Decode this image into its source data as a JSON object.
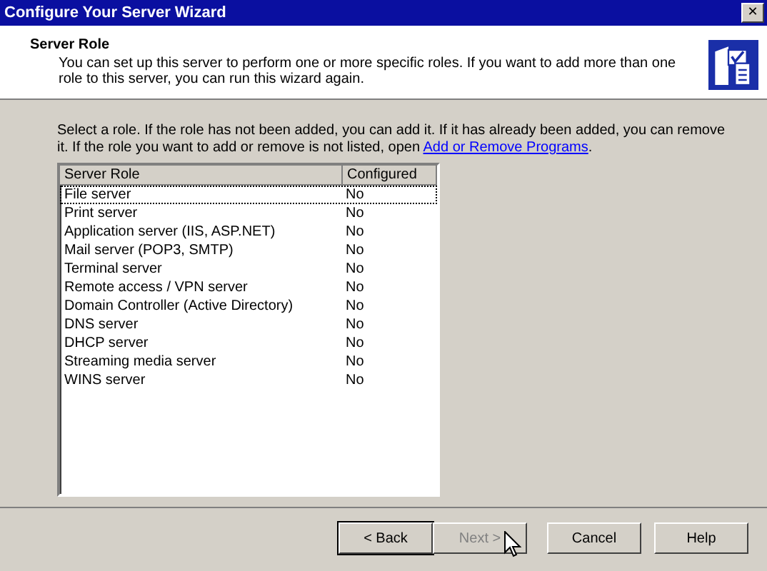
{
  "window": {
    "title": "Configure Your Server Wizard",
    "close": "✕"
  },
  "header": {
    "title": "Server Role",
    "description": "You can set up this server to perform one or more specific roles. If you want to add more than one role to this server, you can run this wizard again."
  },
  "instructions": {
    "text": "Select a role. If the role has not been added, you can add it. If it has already been added, you can remove it. If the role you want to add or remove is not listed, open",
    "link": "Add or Remove Programs",
    "end": "."
  },
  "table": {
    "columns": [
      "Server Role",
      "Configured"
    ],
    "rows": [
      {
        "role": "File server",
        "configured": "No",
        "focused": true
      },
      {
        "role": "Print server",
        "configured": "No",
        "focused": false
      },
      {
        "role": "Application server (IIS, ASP.NET)",
        "configured": "No",
        "focused": false
      },
      {
        "role": "Mail server (POP3, SMTP)",
        "configured": "No",
        "focused": false
      },
      {
        "role": "Terminal server",
        "configured": "No",
        "focused": false
      },
      {
        "role": "Remote access / VPN server",
        "configured": "No",
        "focused": false
      },
      {
        "role": "Domain Controller (Active Directory)",
        "configured": "No",
        "focused": false
      },
      {
        "role": "DNS server",
        "configured": "No",
        "focused": false
      },
      {
        "role": "DHCP server",
        "configured": "No",
        "focused": false
      },
      {
        "role": "Streaming media server",
        "configured": "No",
        "focused": false
      },
      {
        "role": "WINS server",
        "configured": "No",
        "focused": false
      }
    ]
  },
  "buttons": [
    {
      "label": "< Back",
      "disabled": false,
      "default": true
    },
    {
      "label": "Next >",
      "disabled": true,
      "default": false
    },
    {
      "label": "Cancel",
      "disabled": false,
      "default": false
    },
    {
      "label": "Help",
      "disabled": false,
      "default": false
    }
  ]
}
